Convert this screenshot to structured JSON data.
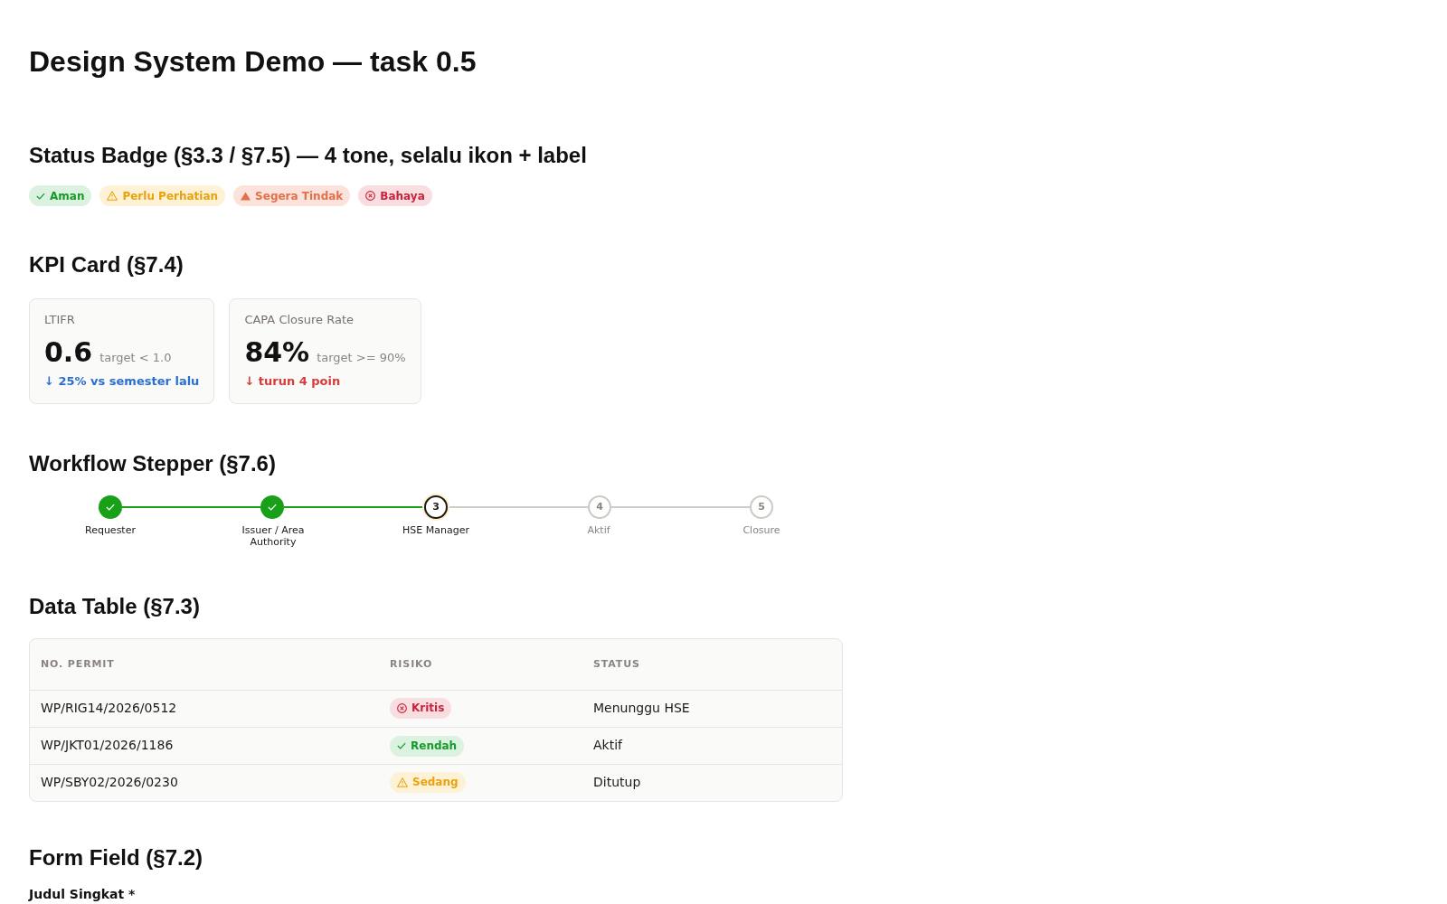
{
  "page_title": "Design System Demo — task 0.5",
  "status_badge_section": {
    "heading": "Status Badge (§3.3 / §7.5) — 4 tone, selalu ikon + label",
    "badges": [
      {
        "label": "Aman",
        "kind": "success"
      },
      {
        "label": "Perlu Perhatian",
        "kind": "warning"
      },
      {
        "label": "Segera Tindak",
        "kind": "alert"
      },
      {
        "label": "Bahaya",
        "kind": "danger"
      }
    ]
  },
  "kpi_section": {
    "heading": "KPI Card (§7.4)",
    "cards": [
      {
        "label": "LTIFR",
        "value": "0.6",
        "target": "target < 1.0",
        "delta": "↓ 25% vs semester lalu",
        "kind": "positive"
      },
      {
        "label": "CAPA Closure Rate",
        "value": "84%",
        "target": "target >= 90%",
        "delta": "↓ turun 4 poin",
        "kind": "negative"
      }
    ]
  },
  "stepper_section": {
    "heading": "Workflow Stepper (§7.6)",
    "steps": [
      {
        "label": "Requester",
        "completed": true,
        "active": false
      },
      {
        "label": "Issuer / Area Authority",
        "completed": true,
        "active": false
      },
      {
        "label": "HSE Manager",
        "number": "3",
        "completed": false,
        "active": true
      },
      {
        "label": "Aktif",
        "number": "4",
        "completed": false,
        "active": false
      },
      {
        "label": "Closure",
        "number": "5",
        "completed": false,
        "active": false
      }
    ]
  },
  "table_section": {
    "heading": "Data Table (§7.3)",
    "columns": [
      "NO. PERMIT",
      "RISIKO",
      "STATUS"
    ],
    "rows": [
      {
        "permit": "WP/RIG14/2026/0512",
        "risk": {
          "label": "Kritis",
          "kind": "danger"
        },
        "status": "Menunggu HSE"
      },
      {
        "permit": "WP/JKT01/2026/1186",
        "risk": {
          "label": "Rendah",
          "kind": "success"
        },
        "status": "Aktif"
      },
      {
        "permit": "WP/SBY02/2026/0230",
        "risk": {
          "label": "Sedang",
          "kind": "warning"
        },
        "status": "Ditutup"
      }
    ]
  },
  "form_section": {
    "heading": "Form Field (§7.2)",
    "field_label": "Judul Singkat *"
  }
}
